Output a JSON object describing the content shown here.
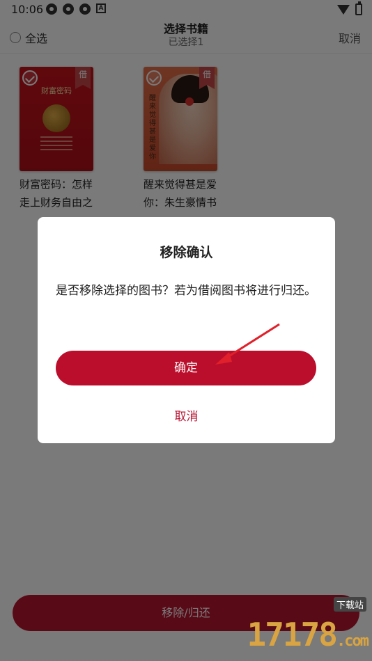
{
  "status_bar": {
    "time": "10:06"
  },
  "header": {
    "select_all_label": "全选",
    "title": "选择书籍",
    "subtitle": "已选择1",
    "cancel_label": "取消"
  },
  "books": [
    {
      "title": "财富密码：怎样走上财务自由之",
      "badge": "借",
      "cover_title": "财富密码"
    },
    {
      "title": "醒来觉得甚是爱你：朱生豪情书",
      "badge": "借",
      "cover_title": "醒来觉得甚是爱你"
    }
  ],
  "bottom_button": {
    "label": "移除/归还"
  },
  "dialog": {
    "title": "移除确认",
    "message": "是否移除选择的图书？若为借阅图书将进行归还。",
    "confirm_label": "确定",
    "cancel_label": "取消"
  },
  "watermark": {
    "number": "17178",
    "domain": ".com",
    "tag": "下载站"
  },
  "colors": {
    "accent": "#bb0e2c",
    "overlay": "rgba(0,0,0,0.52)"
  }
}
